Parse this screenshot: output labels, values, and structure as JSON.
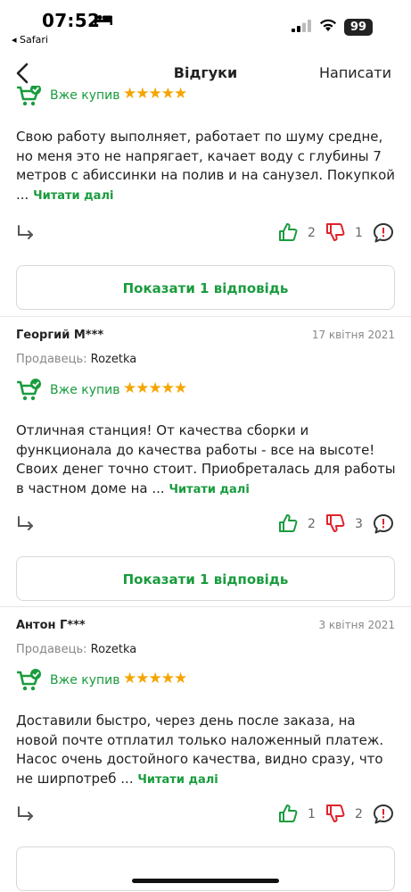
{
  "status": {
    "time": "07:52",
    "back_app": "◂ Safari",
    "battery": "99"
  },
  "nav": {
    "title": "Відгуки",
    "write_label": "Написати"
  },
  "labels": {
    "seller_prefix": "Продавець:",
    "bought": "Вже купив",
    "read_more": "Читати далі",
    "stars": "★★★★★"
  },
  "reviews": [
    {
      "author": "",
      "date": "",
      "seller": "",
      "text": "Свою работу выполняет, работает по шуму средне, но меня это не напрягает, качает воду с глубины 7 метров с абиссинки на полив и на санузел. Покупкой ...",
      "likes": "2",
      "dislikes": "1",
      "replies_label": "Показати 1 відповідь"
    },
    {
      "author": "Георгий М***",
      "date": "17 квітня 2021",
      "seller": "Rozetka",
      "text": "Отличная станция! От качества сборки и функционала до качества работы - все на высоте! Своих денег точно стоит. Приобреталась для работы в частном доме на ...",
      "likes": "2",
      "dislikes": "3",
      "replies_label": "Показати 1 відповідь"
    },
    {
      "author": "Антон Г***",
      "date": "3 квітня 2021",
      "seller": "Rozetka",
      "text": "Доставили быстро, через день после заказа, на новой почте отплатил только наложенный платеж. Насос очень достойного качества, видно сразу, что не ширпотреб ...",
      "likes": "1",
      "dislikes": "2",
      "replies_label": ""
    }
  ]
}
